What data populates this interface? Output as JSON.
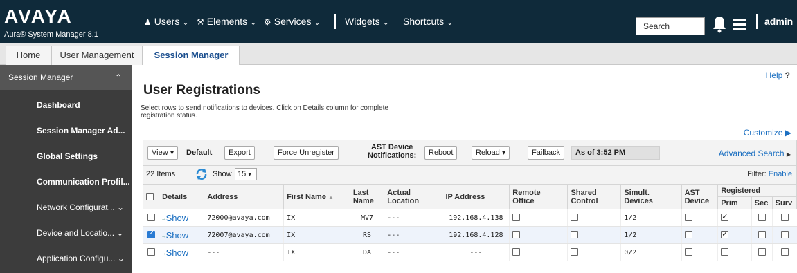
{
  "header": {
    "logo": "AVAYA",
    "product": "Aura® System Manager 8.1",
    "nav": [
      "Users",
      "Elements",
      "Services",
      "Widgets",
      "Shortcuts"
    ],
    "search_placeholder": "Search",
    "user": "admin",
    "icons": [
      "user-icon",
      "wrench-icon",
      "gear-icon",
      "bell-icon",
      "menu-icon"
    ]
  },
  "tabs": [
    {
      "label": "Home",
      "active": false
    },
    {
      "label": "User Management",
      "active": false
    },
    {
      "label": "Session Manager",
      "active": true
    }
  ],
  "sidebar": {
    "header": "Session Manager",
    "items": [
      "Dashboard",
      "Session Manager Ad...",
      "Global Settings",
      "Communication Profil...",
      "Network Configurat...",
      "Device and Locatio...",
      "Application Configu..."
    ]
  },
  "main": {
    "help": "Help",
    "help_mark": "?",
    "title": "User Registrations",
    "description": "Select rows to send notifications to devices. Click on Details column for complete registration status.",
    "customize": "Customize",
    "toolbar": {
      "view": "View",
      "default": "Default",
      "export": "Export",
      "force_unregister": "Force Unregister",
      "ast_notifications_1": "AST Device",
      "ast_notifications_2": "Notifications:",
      "reboot": "Reboot",
      "reload": "Reload",
      "failback": "Failback",
      "as_of": "As of 3:52 PM",
      "advanced_search": "Advanced Search"
    },
    "count": "22 Items",
    "show_label": "Show",
    "show_value": "15",
    "filter_label": "Filter:",
    "filter_action": "Enable",
    "columns": {
      "details": "Details",
      "address": "Address",
      "first_name": "First Name",
      "last_name_1": "Last",
      "last_name_2": "Name",
      "actual_location_1": "Actual",
      "actual_location_2": "Location",
      "ip": "IP Address",
      "remote_office_1": "Remote",
      "remote_office_2": "Office",
      "shared_control_1": "Shared",
      "shared_control_2": "Control",
      "simult_1": "Simult.",
      "simult_2": "Devices",
      "ast_1": "AST",
      "ast_2": "Device",
      "registered": "Registered",
      "prim": "Prim",
      "sec": "Sec",
      "surv": "Surv"
    },
    "rows": [
      {
        "selected": false,
        "details": "Show",
        "address": "72000@avaya.com",
        "first_name": "IX",
        "last_name": "MV7",
        "location": "---",
        "ip": "192.168.4.138",
        "remote": false,
        "shared": false,
        "simult": "1/2",
        "ast": false,
        "prim": true,
        "sec": false,
        "surv": false
      },
      {
        "selected": true,
        "details": "Show",
        "address": "72007@avaya.com",
        "first_name": "IX",
        "last_name": "RS",
        "location": "---",
        "ip": "192.168.4.128",
        "remote": false,
        "shared": false,
        "simult": "1/2",
        "ast": false,
        "prim": true,
        "sec": false,
        "surv": false
      },
      {
        "selected": false,
        "details": "Show",
        "address": "---",
        "first_name": "IX",
        "last_name": "DA",
        "location": "---",
        "ip": "---",
        "remote": false,
        "shared": false,
        "simult": "0/2",
        "ast": false,
        "prim": false,
        "sec": false,
        "surv": false
      }
    ]
  }
}
